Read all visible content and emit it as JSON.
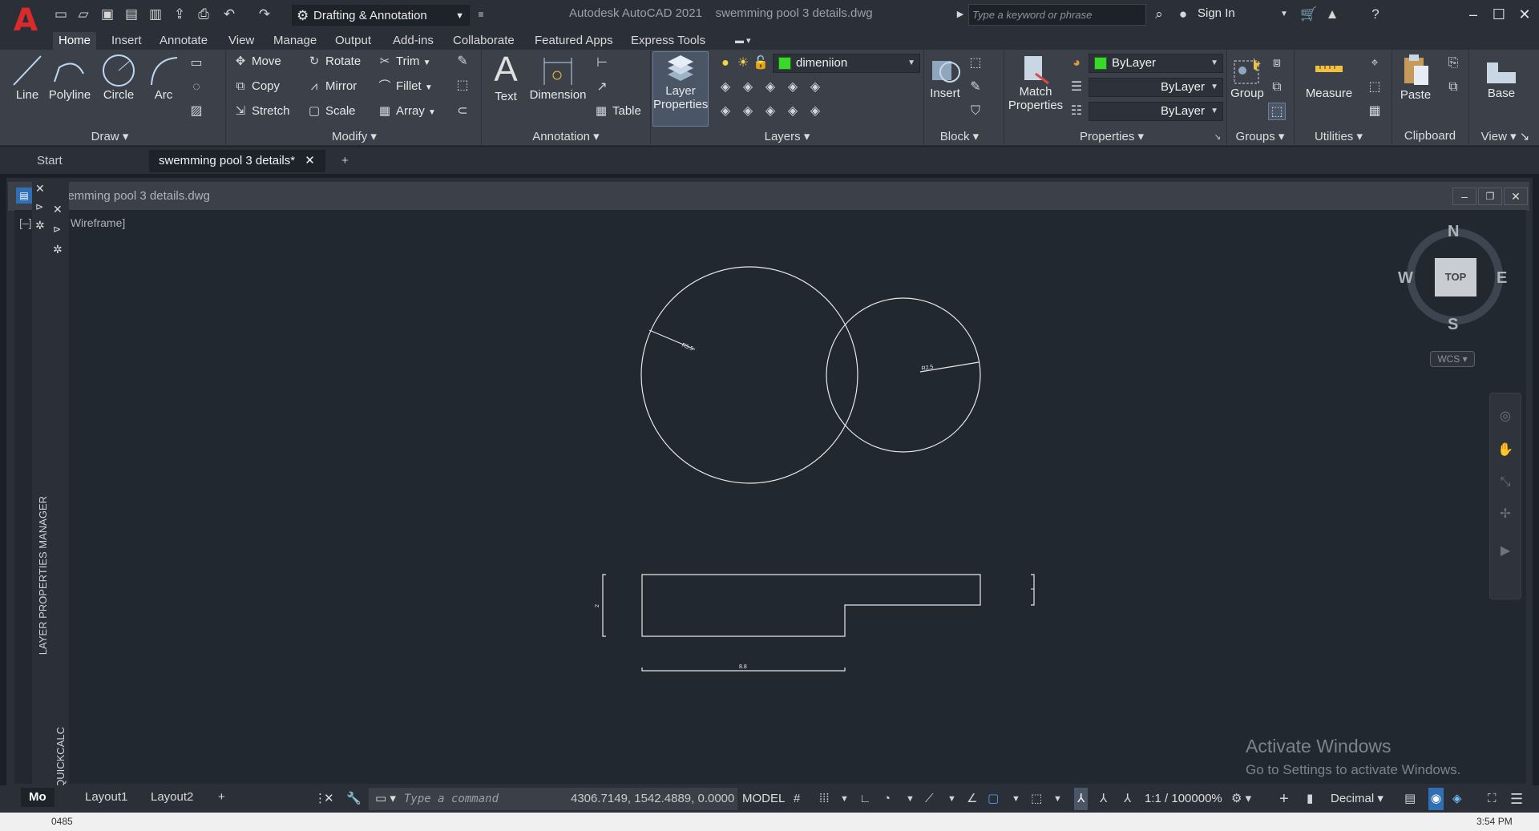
{
  "app": {
    "logo": "A",
    "title": "Autodesk AutoCAD 2021",
    "filename": "swemming pool 3 details.dwg",
    "workspace": "Drafting & Annotation",
    "search_placeholder": "Type a keyword or phrase",
    "sign_in": "Sign In"
  },
  "ribbon_tabs": [
    "Home",
    "Insert",
    "Annotate",
    "View",
    "Manage",
    "Output",
    "Add-ins",
    "Collaborate",
    "Featured Apps",
    "Express Tools"
  ],
  "ribbon": {
    "draw": {
      "title": "Draw",
      "line": "Line",
      "polyline": "Polyline",
      "circle": "Circle",
      "arc": "Arc"
    },
    "modify": {
      "title": "Modify",
      "move": "Move",
      "rotate": "Rotate",
      "trim": "Trim",
      "copy": "Copy",
      "mirror": "Mirror",
      "fillet": "Fillet",
      "stretch": "Stretch",
      "scale": "Scale",
      "array": "Array"
    },
    "annotation": {
      "title": "Annotation",
      "text": "Text",
      "dimension": "Dimension",
      "table": "Table"
    },
    "layers": {
      "title": "Layers",
      "layer_properties_l1": "Layer",
      "layer_properties_l2": "Properties",
      "current_layer": "dimeniion",
      "layer_color": "#39d82a"
    },
    "block": {
      "title": "Block",
      "insert": "Insert"
    },
    "properties": {
      "title": "Properties",
      "match_l1": "Match",
      "match_l2": "Properties",
      "color": "ByLayer",
      "linetype": "ByLayer",
      "lineweight": "ByLayer"
    },
    "groups": {
      "title": "Groups",
      "group": "Group"
    },
    "utilities": {
      "title": "Utilities",
      "measure": "Measure"
    },
    "clipboard": {
      "title": "Clipboard",
      "paste": "Paste"
    },
    "view": {
      "title": "View",
      "base": "Base"
    }
  },
  "file_tabs": {
    "start": "Start",
    "active": "swemming pool 3 details*"
  },
  "document": {
    "title": "swemming pool 3 details.dwg",
    "view_label": "D Wireframe]"
  },
  "palettes": {
    "layer_manager": "LAYER PROPERTIES MANAGER",
    "quickcalc": "QUICKCALC"
  },
  "drawing": {
    "circle1_label": "R5.5",
    "circle2_label": "R2.5",
    "height_label": "2",
    "width_label": "8.8"
  },
  "viewcube": {
    "top": "TOP",
    "n": "N",
    "s": "S",
    "e": "E",
    "w": "W",
    "wcs": "WCS"
  },
  "watermark": {
    "line1": "Activate Windows",
    "line2": "Go to Settings to activate Windows."
  },
  "status": {
    "model_tab": "Mo",
    "layout1": "Layout1",
    "layout2": "Layout2",
    "command_placeholder": "Type a command",
    "coords": "4306.7149, 1542.4889, 0.0000",
    "model": "MODEL",
    "scale": "1:1 / 100000%",
    "units": "Decimal"
  },
  "taskbar": {
    "left": "0485",
    "right": "3:54 PM"
  }
}
